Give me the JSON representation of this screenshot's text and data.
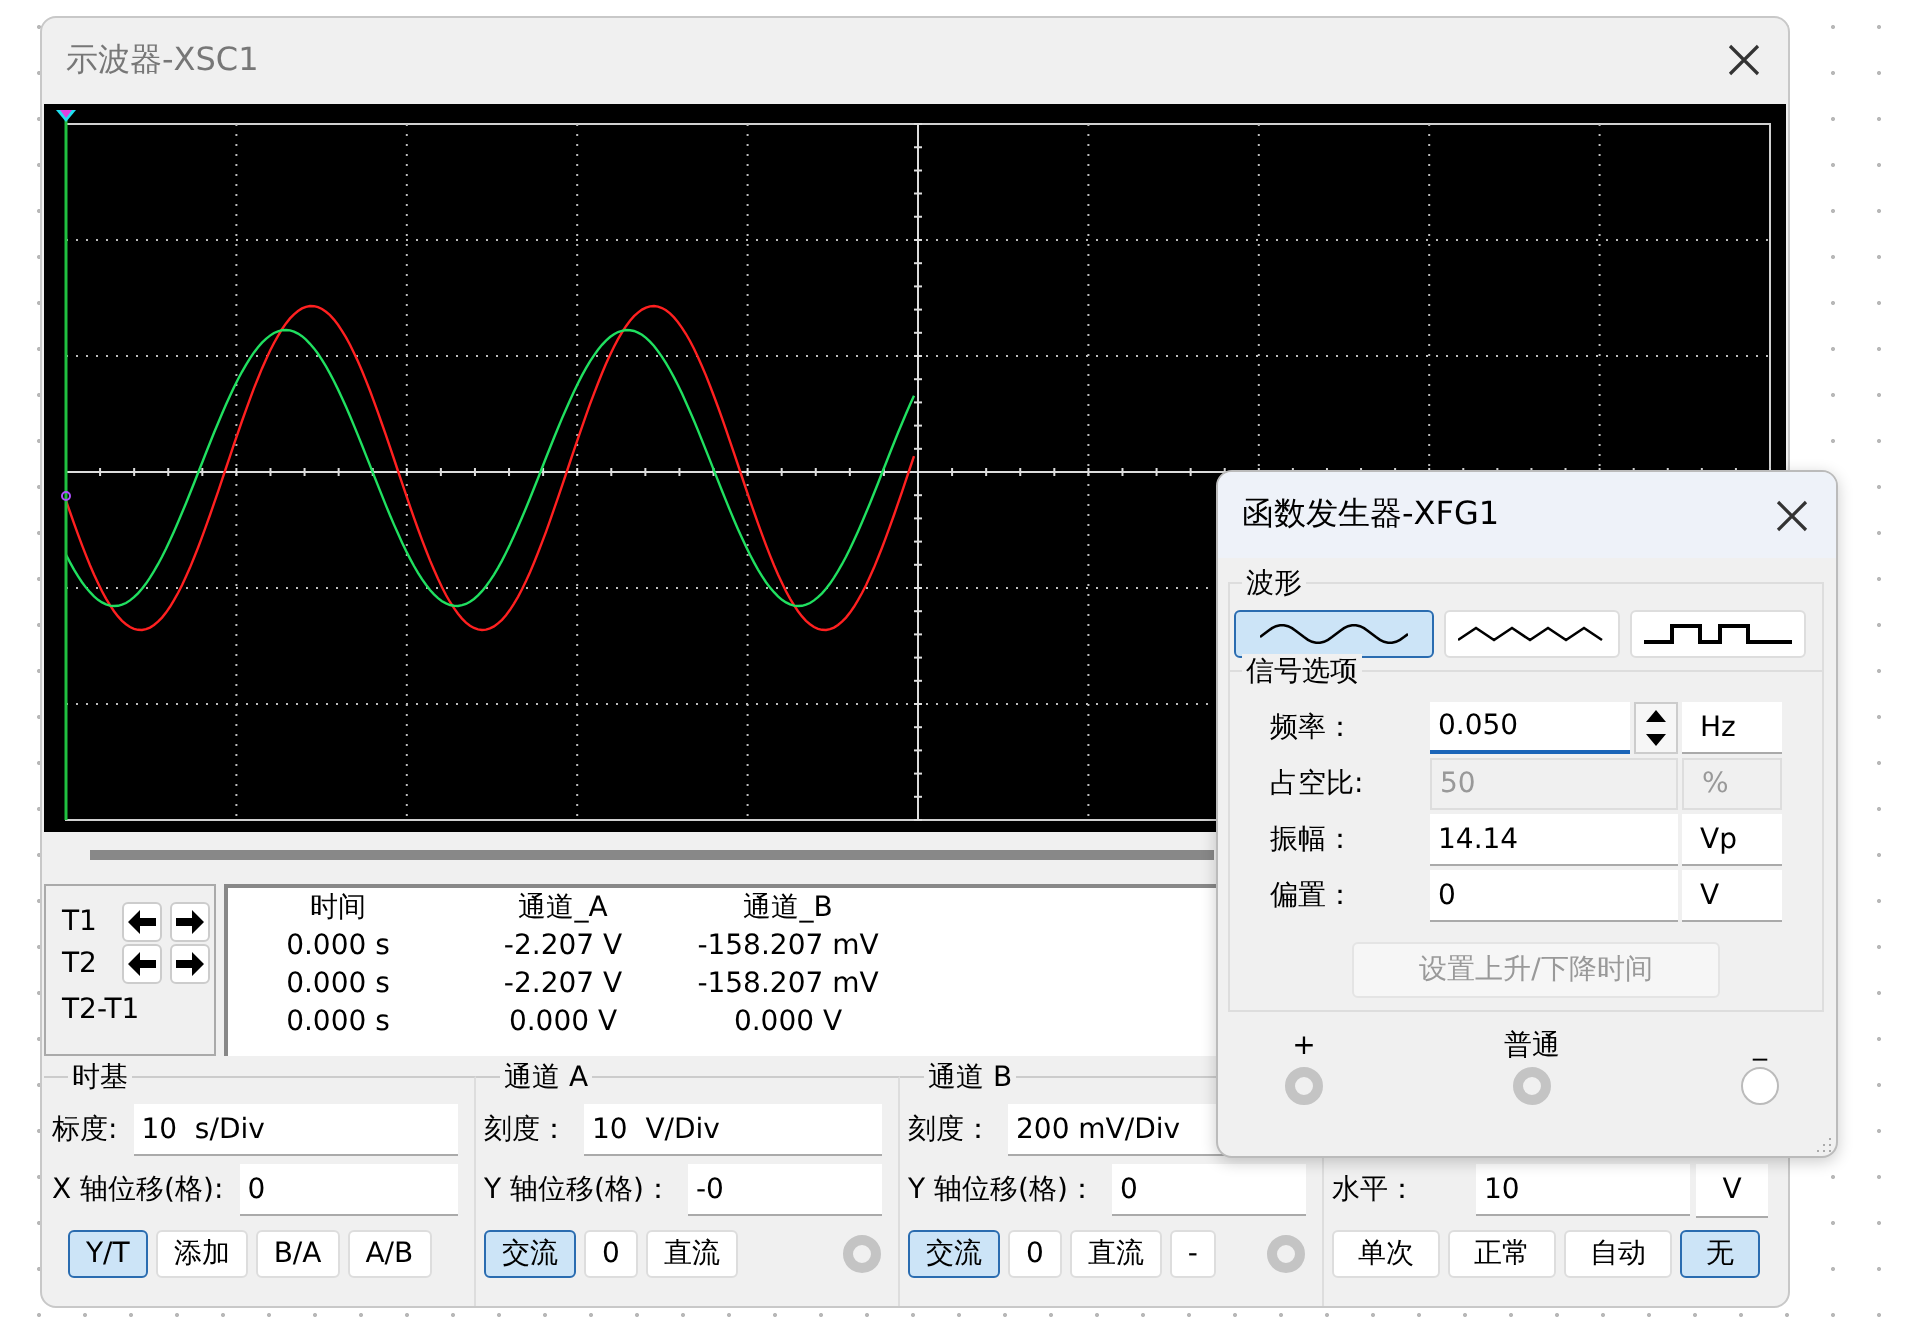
{
  "oscilloscope": {
    "title": "示波器-XSC1",
    "cursors": [
      {
        "label": "T1"
      },
      {
        "label": "T2"
      }
    ],
    "difference_label": "T2-T1",
    "readout": {
      "columns": [
        "时间",
        "通道_A",
        "通道_B"
      ],
      "rows": [
        [
          "0.000 s",
          "-2.207 V",
          "-158.207 mV"
        ],
        [
          "0.000 s",
          "-2.207 V",
          "-158.207 mV"
        ],
        [
          "0.000 s",
          "0.000 V",
          "0.000 V"
        ]
      ]
    },
    "timebase": {
      "title": "时基",
      "fields": [
        {
          "label": "标度:",
          "value": "10  s/Div"
        },
        {
          "label": "X 轴位移(格):",
          "value": "0"
        }
      ],
      "modes": [
        {
          "label": "Y/T",
          "selected": true
        },
        {
          "label": "添加",
          "selected": false
        },
        {
          "label": "B/A",
          "selected": false
        },
        {
          "label": "A/B",
          "selected": false
        }
      ]
    },
    "channel_a": {
      "title": "通道 A",
      "fields": [
        {
          "label": "刻度：",
          "value": "10  V/Div"
        },
        {
          "label": "Y 轴位移(格)：",
          "value": "-0"
        }
      ],
      "coupling": [
        {
          "label": "交流",
          "selected": true
        },
        {
          "label": "0",
          "selected": false
        },
        {
          "label": "直流",
          "selected": false
        }
      ]
    },
    "channel_b": {
      "title": "通道 B",
      "fields": [
        {
          "label": "刻度：",
          "value": "200 mV/Div"
        },
        {
          "label": "Y 轴位移(格)：",
          "value": "0"
        }
      ],
      "coupling": [
        {
          "label": "交流",
          "selected": true
        },
        {
          "label": "0",
          "selected": false
        },
        {
          "label": "直流",
          "selected": false
        },
        {
          "label": "-",
          "selected": false
        }
      ]
    },
    "trigger": {
      "level": {
        "label": "水平：",
        "value": "10",
        "unit": "V"
      },
      "modes": [
        {
          "label": "单次",
          "selected": false
        },
        {
          "label": "正常",
          "selected": false
        },
        {
          "label": "自动",
          "selected": false
        },
        {
          "label": "无",
          "selected": true
        }
      ]
    }
  },
  "function_generator": {
    "title": "函数发生器-XFG1",
    "waveform_title": "波形",
    "waveforms": [
      {
        "kind": "sine",
        "selected": true
      },
      {
        "kind": "triangle",
        "selected": false
      },
      {
        "kind": "square",
        "selected": false
      }
    ],
    "options_title": "信号选项",
    "params": [
      {
        "label": "频率：",
        "value": "0.050",
        "unit": "Hz",
        "kind": "spin",
        "disabled": false
      },
      {
        "label": "占空比:",
        "value": "50",
        "unit": "%",
        "kind": "plain",
        "disabled": true
      },
      {
        "label": "振幅：",
        "value": "14.14",
        "unit": "Vp",
        "kind": "plain",
        "disabled": false
      },
      {
        "label": "偏置：",
        "value": "0",
        "unit": "V",
        "kind": "plain",
        "disabled": false
      }
    ],
    "rise_fall_button": {
      "label": "设置上升/下降时间",
      "disabled": true
    },
    "terminals": [
      {
        "label": "+",
        "connected": true
      },
      {
        "label": "普通",
        "connected": true
      },
      {
        "label": "_",
        "connected": false
      }
    ]
  }
}
